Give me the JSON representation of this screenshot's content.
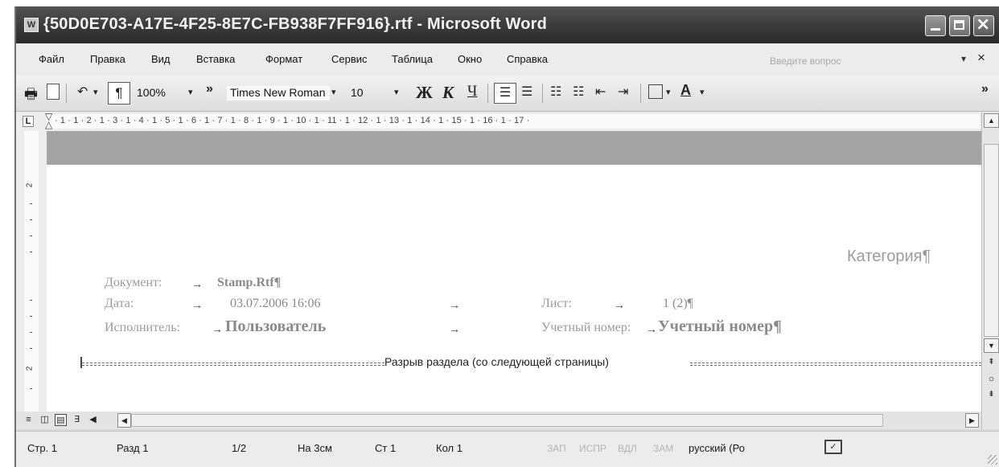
{
  "window": {
    "title": "{50D0E703-A17E-4F25-8E7C-FB938F7FF916}.rtf - Microsoft Word",
    "app_icon": "W"
  },
  "menu": {
    "items": [
      "Файл",
      "Правка",
      "Вид",
      "Вставка",
      "Формат",
      "Сервис",
      "Таблица",
      "Окно",
      "Справка"
    ],
    "ask_placeholder": "Введите вопрос"
  },
  "toolbar": {
    "zoom": "100%",
    "font": "Times New Roman",
    "size": "10",
    "bold": "Ж",
    "italic": "К",
    "underline": "Ч",
    "pilcrow": "¶",
    "more": "»",
    "font_color_letter": "А"
  },
  "ruler": {
    "tab_selector": "L",
    "marks": "· 1 · 1 · 2 · 1 · 3 · 1 · 4 · 1 · 5 · 1 · 6 · 1 · 7 · 1 · 8 · 1 · 9 · 1 · 10 · 1 · 11 · 1 · 12 · 1 · 13 · 1 · 14 · 1 · 15 · 1 · 16 · 1 · 17 ·",
    "vertical_number": "2"
  },
  "document": {
    "category": "Категория¶",
    "rows": [
      {
        "label": "Документ:",
        "value": "Stamp.Rtf¶"
      },
      {
        "label": "Дата:",
        "value": "03.07.2006 16:06",
        "label2": "Лист:",
        "value2": "1 (2)¶"
      },
      {
        "label": "Исполнитель:",
        "value": "Пользователь",
        "label2": "Учетный номер:",
        "value2": "Учетный номер¶"
      }
    ],
    "arrow": "→",
    "section_break": "Разрыв раздела (со следующей страницы)"
  },
  "status": {
    "page": "Стр. 1",
    "section": "Разд 1",
    "pages": "1/2",
    "at": "На 3см",
    "line": "Ст 1",
    "col": "Кол 1",
    "rec": "ЗАП",
    "trk": "ИСПР",
    "ext": "ВДЛ",
    "ovr": "ЗАМ",
    "language": "русский (Ро"
  }
}
